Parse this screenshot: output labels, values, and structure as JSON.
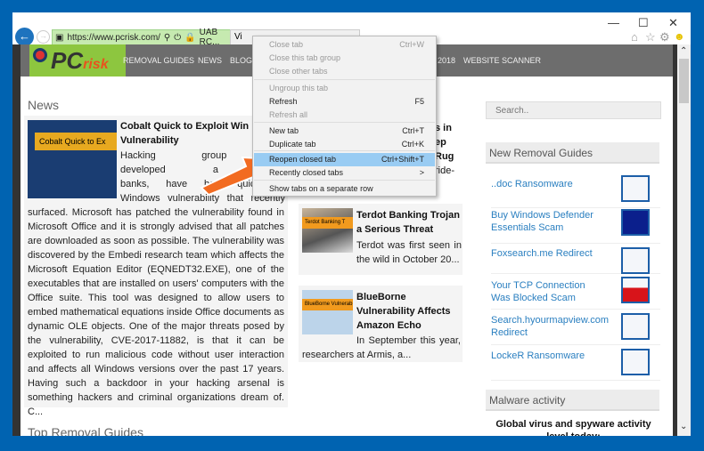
{
  "browser": {
    "address_url": "https://www.pcrisk.com/",
    "site_cert": "UAB RC...",
    "tab2_title": "Vi"
  },
  "nav": {
    "logo_text": "PCrisk",
    "items": [
      "REMOVAL GUIDES",
      "NEWS",
      "BLOG",
      "2018",
      "WEBSITE SCANNER"
    ]
  },
  "news": {
    "heading": "News",
    "main": {
      "thumb_label": "Cobalt Quick to Ex",
      "title": "Cobalt Quick to Exploit Win Vulnerability",
      "lines_top": [
        "Hacking group Co",
        "developed a repu",
        "banks, have bee  quick to",
        "Windows vulnerability that recently"
      ],
      "body": "surfaced. Microsoft has patched the vulnerability found in Microsoft Office and it is strongly advised that all patches are downloaded as soon as possible. The vulnerability was discovered by the Embedi research team which affects the Microsoft Equation Editor (EQNEDT32.EXE), one of the executables that are installed on users' computers with the Office suite. This tool was designed to allow users to embed mathematical equations inside Office documents as dynamic OLE objects. One of the major threats posed by the vulnerability, CVE-2017-11882, is that it can be exploited to run malicious code without user interaction and affects all Windows versions over the past 17 years. Having such a backdoor in your hacking arsenal is something hackers and criminal organizations dream of. C..."
    },
    "partial": [
      "s in",
      "ep",
      "Rug",
      "ride-"
    ],
    "items": [
      {
        "thumb_label": "Terdot Banking T",
        "title": "Terdot Banking Trojan a Serious Threat",
        "text": "Terdot was first seen in the wild in October 20..."
      },
      {
        "thumb_label": "BlueBorne Vulnerab",
        "title": "BlueBorne Vulnerability Affects Amazon Echo",
        "text": "In September this year, researchers at Armis, a..."
      }
    ],
    "bottom_heading": "Top Removal Guides"
  },
  "sidebar": {
    "search_placeholder": "Search..",
    "new_guides_heading": "New Removal Guides",
    "guides": [
      "..doc Ransomware",
      "Buy Windows Defender Essentials Scam",
      "Foxsearch.me Redirect",
      "Your TCP Connection Was Blocked Scam",
      "Search.hyourmapview.com Redirect",
      "LockeR Ransomware"
    ],
    "malware_heading": "Malware activity",
    "malware_text": "Global virus and spyware activity level today:"
  },
  "context_menu": [
    {
      "label": "Close tab",
      "shortcut": "Ctrl+W",
      "disabled": true
    },
    {
      "label": "Close this tab group",
      "shortcut": "",
      "disabled": true
    },
    {
      "label": "Close other tabs",
      "shortcut": "",
      "disabled": true
    },
    {
      "label": "Ungroup this tab",
      "shortcut": "",
      "disabled": true
    },
    {
      "label": "Refresh",
      "shortcut": "F5",
      "disabled": false
    },
    {
      "label": "Refresh all",
      "shortcut": "",
      "disabled": true
    },
    {
      "label": "New tab",
      "shortcut": "Ctrl+T",
      "disabled": false
    },
    {
      "label": "Duplicate tab",
      "shortcut": "Ctrl+K",
      "disabled": false
    },
    {
      "label": "Reopen closed tab",
      "shortcut": "Ctrl+Shift+T",
      "disabled": false
    },
    {
      "label": "Recently closed tabs",
      "shortcut": ">",
      "disabled": false
    },
    {
      "label": "Show tabs on a separate row",
      "shortcut": "",
      "disabled": false
    }
  ],
  "colors": {
    "accent": "#0063b1",
    "highlight": "#99ccf3",
    "logo": "#8dc63f",
    "link": "#2a7fc0"
  }
}
